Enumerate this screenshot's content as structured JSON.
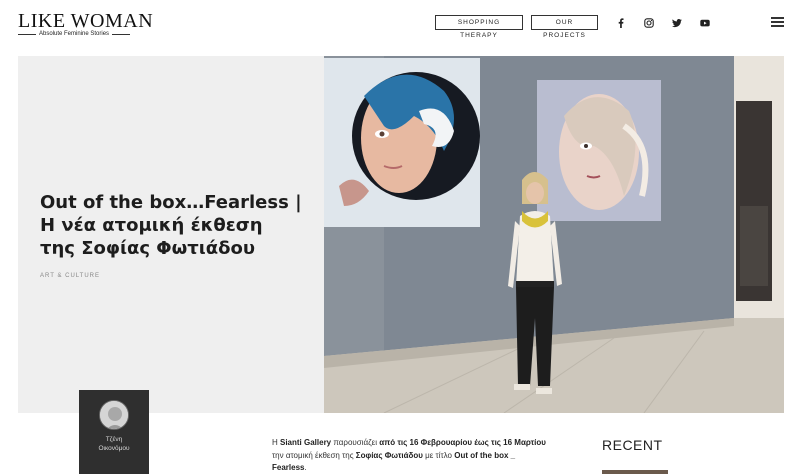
{
  "header": {
    "logo_main": "LIKE WOMAN",
    "logo_sub": "Absolute Feminine Stories",
    "nav": [
      {
        "label": "SHOPPING THERAPY"
      },
      {
        "label": "OUR PROJECTS"
      }
    ],
    "social_icons": [
      "facebook-icon",
      "instagram-icon",
      "twitter-icon",
      "youtube-icon"
    ],
    "menu_icon": "hamburger-menu-icon"
  },
  "hero": {
    "title_line1": "Out of the box…Fearless |",
    "title_line2": "Η νέα ατομική έκθεση",
    "title_line3": "της Σοφίας Φωτιάδου",
    "category": "ART & CULTURE"
  },
  "author": {
    "name_line1": "Τζένη",
    "name_line2": "Οικονόμου"
  },
  "article": {
    "p1_a": "Η ",
    "p1_b": "Sianti Gallery",
    "p1_c": " παρουσιάζει ",
    "p1_d": "από τις 16 Φεβρουαρίου έως τις 16 Μαρτίου",
    "p1_e": " την ατομική έκθεση της ",
    "p1_f": "Σοφίας Φωτιάδου",
    "p1_g": " με τίτλο ",
    "p1_h": "Out of the box _ Fearless",
    "p1_i": "."
  },
  "sidebar": {
    "recent_title": "RECENT"
  },
  "colors": {
    "hero_bg": "#efefef",
    "author_card_bg": "#2f2f2f",
    "wall": "#7e8894",
    "floor": "#cfc9be"
  }
}
